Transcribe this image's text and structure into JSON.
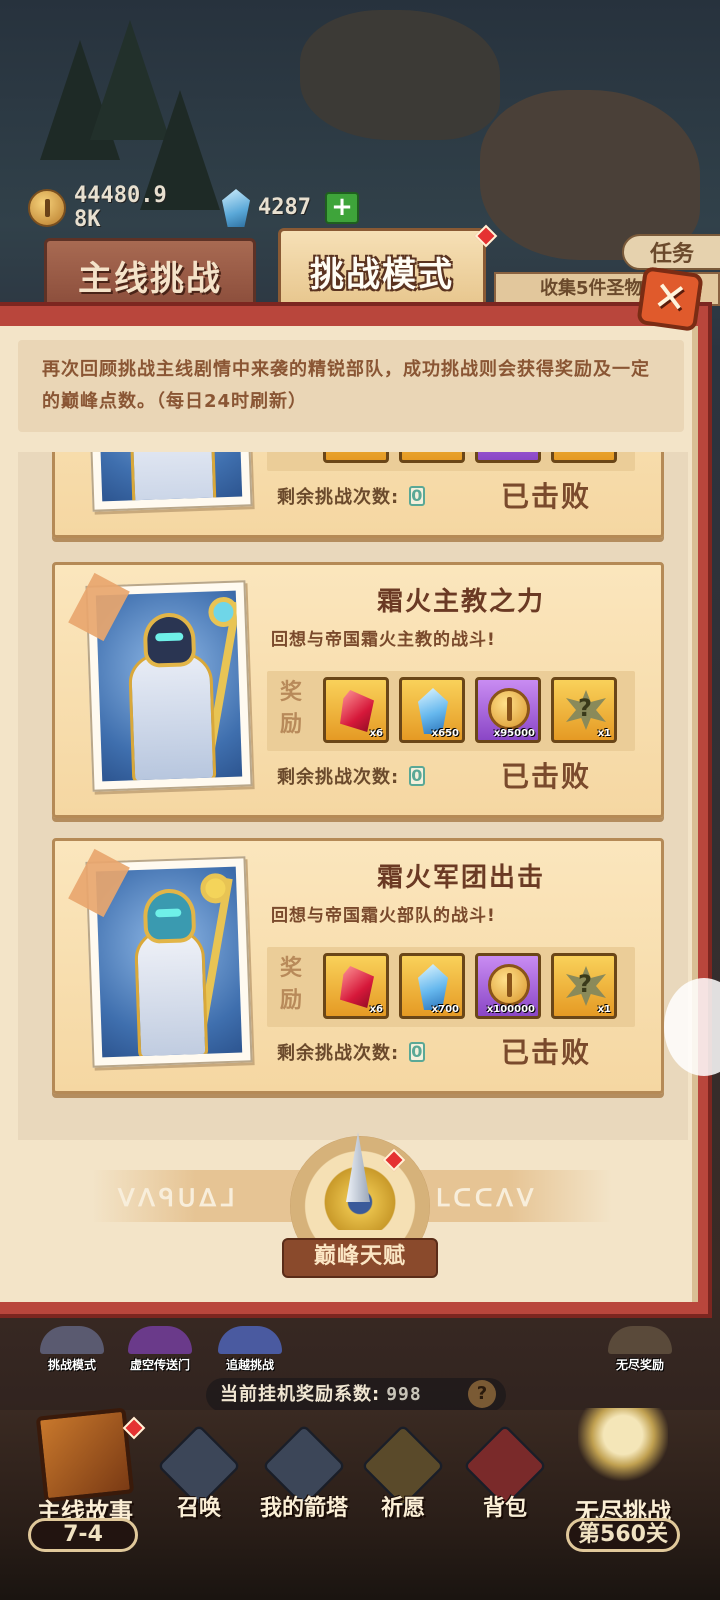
{
  "resources": {
    "coins": "44480.98K",
    "gems": "4287"
  },
  "tabs": {
    "main": "主线挑战",
    "challenge": "挑战模式"
  },
  "task": {
    "label": "任务",
    "strip": "收集5件圣物"
  },
  "intro": "再次回顾挑战主线剧情中来袭的精锐部队，成功挑战则会获得奖励及一定的巅峰点数。（每日24时刷新）",
  "common": {
    "reward_label": "奖励",
    "remaining_label": "剩余挑战次数:",
    "defeated": "已击败"
  },
  "cards": [
    {
      "title": "",
      "desc": "",
      "remaining": "0",
      "status": "已击败"
    },
    {
      "title": "霜火主教之力",
      "desc": "回想与帝国霜火主教的战斗!",
      "rewards": [
        {
          "icon": "red-crystal-icon",
          "qty": "x6"
        },
        {
          "icon": "blue-crystal-icon",
          "qty": "x650"
        },
        {
          "icon": "gold-coin-icon",
          "qty": "x95000"
        },
        {
          "icon": "mystery-item-icon",
          "qty": "x1"
        }
      ],
      "remaining": "0",
      "status": "已击败"
    },
    {
      "title": "霜火军团出击",
      "desc": "回想与帝国霜火部队的战斗!",
      "rewards": [
        {
          "icon": "red-crystal-icon",
          "qty": "x6"
        },
        {
          "icon": "blue-crystal-icon",
          "qty": "x700"
        },
        {
          "icon": "gold-coin-icon",
          "qty": "x100000"
        },
        {
          "icon": "mystery-item-icon",
          "qty": "x1"
        }
      ],
      "remaining": "0",
      "status": "已击败"
    }
  ],
  "talent": {
    "label": "巅峰天赋",
    "rune_left": "ᐯᐱᑫᑌᐃᒧ",
    "rune_right": "ᒪᑕᑕᐱᐯ"
  },
  "hud": {
    "mini": [
      "挑战模式",
      "虚空传送门",
      "追越挑战",
      "无尽奖励"
    ],
    "coef_label": "当前挂机奖励系数:",
    "coef_value": "998",
    "help": "?"
  },
  "dock": {
    "story": "主线故事",
    "story_stage": "7-4",
    "summon": "召唤",
    "tower": "我的箭塔",
    "pray": "祈愿",
    "bag": "背包",
    "endless": "无尽挑战",
    "endless_stage": "第560关"
  },
  "colors": {
    "panel_frame": "#b9463c",
    "parchment": "#f3e4c8",
    "card": "#f5d7a2",
    "accent_red": "#e53232"
  }
}
